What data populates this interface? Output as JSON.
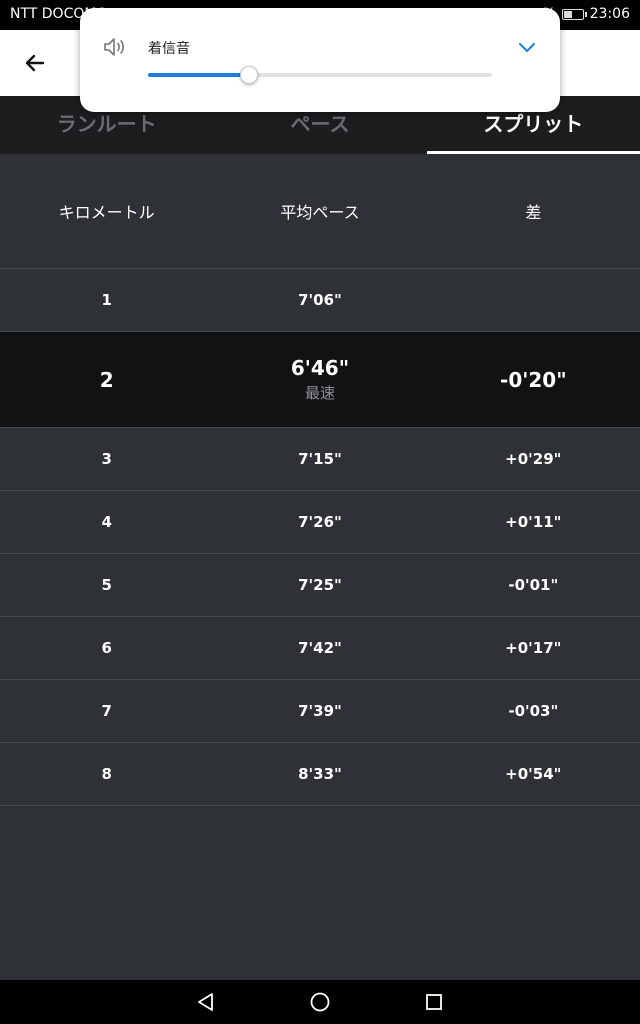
{
  "status_bar": {
    "carrier": "NTT DOCOMO",
    "battery_text": "%",
    "time": "23:06"
  },
  "volume_popup": {
    "label": "着信音",
    "level": 0.29,
    "icons": [
      "speaker-icon",
      "chevron-down-icon"
    ]
  },
  "tabs": [
    {
      "label": "ランルート",
      "active": false
    },
    {
      "label": "ペース",
      "active": false
    },
    {
      "label": "スプリット",
      "active": true
    }
  ],
  "table": {
    "headers": [
      "キロメートル",
      "平均ペース",
      "差"
    ],
    "rows": [
      {
        "km": "1",
        "pace": "7'06\"",
        "diff": "",
        "diff_sign": ""
      },
      {
        "km": "2",
        "pace": "6'46\"",
        "note": "最速",
        "diff": "-0'20\"",
        "diff_sign": "neg",
        "fastest": true
      },
      {
        "km": "3",
        "pace": "7'15\"",
        "diff": "+0'29\"",
        "diff_sign": "pos"
      },
      {
        "km": "4",
        "pace": "7'26\"",
        "diff": "+0'11\"",
        "diff_sign": "pos"
      },
      {
        "km": "5",
        "pace": "7'25\"",
        "diff": "-0'01\"",
        "diff_sign": "neg"
      },
      {
        "km": "6",
        "pace": "7'42\"",
        "diff": "+0'17\"",
        "diff_sign": "pos"
      },
      {
        "km": "7",
        "pace": "7'39\"",
        "diff": "-0'03\"",
        "diff_sign": "neg"
      },
      {
        "km": "8",
        "pace": "8'33\"",
        "diff": "+0'54\"",
        "diff_sign": "pos"
      }
    ]
  },
  "colors": {
    "positive_diff": "#ff5a1f",
    "negative_diff": "#d4f542",
    "slider_accent": "#1e7fe0"
  }
}
